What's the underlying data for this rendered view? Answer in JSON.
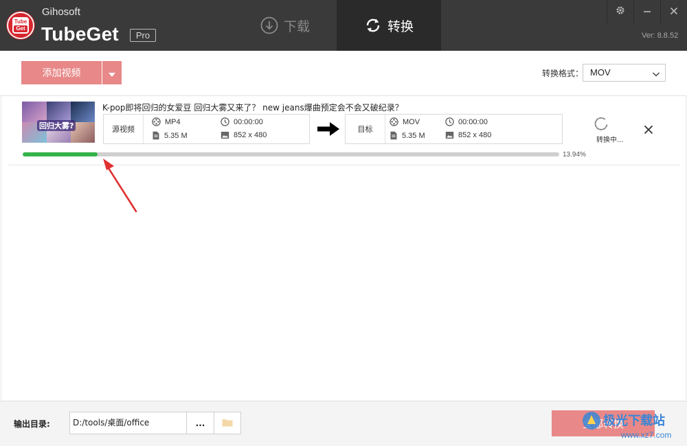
{
  "app": {
    "vendor": "Gihosoft",
    "name": "TubeGet",
    "edition": "Pro",
    "version": "Ver: 8.8.52"
  },
  "nav": {
    "download_label": "下载",
    "convert_label": "转换",
    "active": "convert"
  },
  "toolbar": {
    "add_video_label": "添加视频",
    "format_label": "转换格式：",
    "format_value": "MOV"
  },
  "items": [
    {
      "title": "K-pop即将回归的女爱豆 回归大雾又来了？ new jeans爆曲预定会不会又破纪录？",
      "thumbnail_caption": "回归大雾?",
      "source": {
        "label": "源视频",
        "format": "MP4",
        "duration": "00:00:00",
        "size": "5.35 M",
        "resolution": "852 x 480"
      },
      "target": {
        "label": "目标",
        "format": "MOV",
        "duration": "00:00:00",
        "size": "5.35 M",
        "resolution": "852 x 480"
      },
      "status": "转换中...",
      "progress": 0.1394,
      "progress_text": "13.94%"
    }
  ],
  "footer": {
    "output_label": "输出目录:",
    "output_path": "D:/tools/桌面/office",
    "browse_label": "...",
    "convert_all_label": "全部转换"
  },
  "watermark": {
    "text": "极光下载站",
    "url": "www.xz7.com"
  },
  "colors": {
    "titlebar": "#3a3a3a",
    "accent_button": "#e88888",
    "progress": "#34b34a",
    "annotation": "#e03030"
  }
}
